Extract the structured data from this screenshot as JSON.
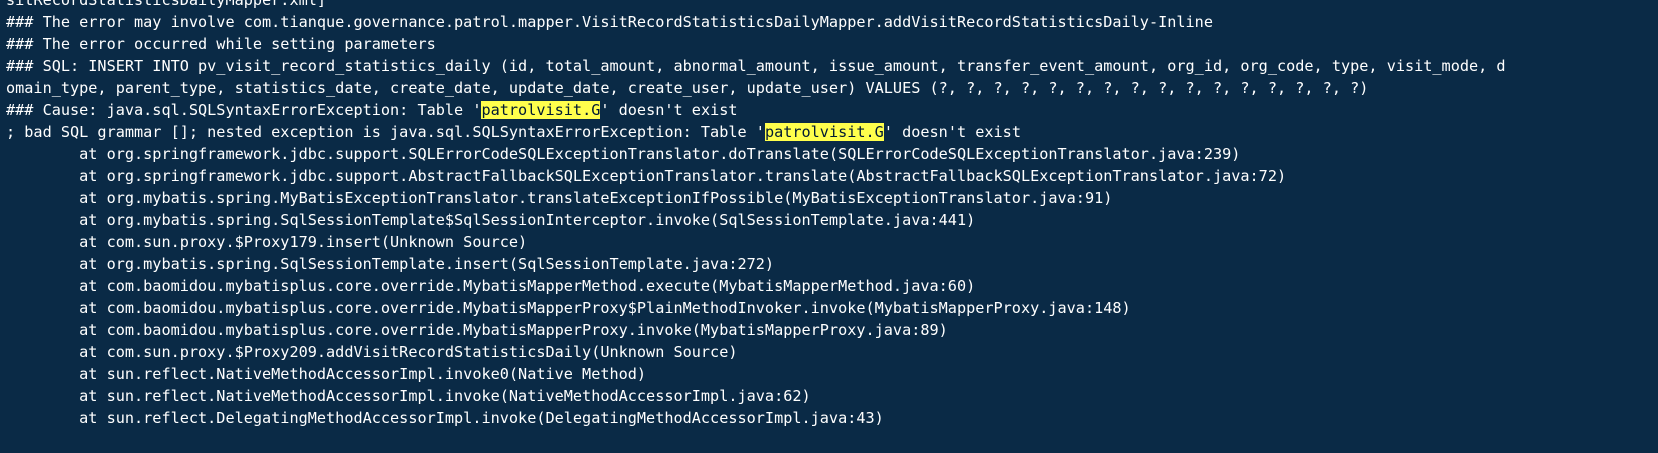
{
  "terminal": {
    "lines": [
      {
        "segments": [
          {
            "text": "sitRecordStatisticsDailyMapper.xml]"
          }
        ]
      },
      {
        "segments": [
          {
            "text": "### The error may involve com.tianque.governance.patrol.mapper.VisitRecordStatisticsDailyMapper.addVisitRecordStatisticsDaily-Inline"
          }
        ]
      },
      {
        "segments": [
          {
            "text": "### The error occurred while setting parameters"
          }
        ]
      },
      {
        "segments": [
          {
            "text": "### SQL: INSERT INTO pv_visit_record_statistics_daily (id, total_amount, abnormal_amount, issue_amount, transfer_event_amount, org_id, org_code, type, visit_mode, d"
          }
        ]
      },
      {
        "segments": [
          {
            "text": "omain_type, parent_type, statistics_date, create_date, update_date, create_user, update_user) VALUES (?, ?, ?, ?, ?, ?, ?, ?, ?, ?, ?, ?, ?, ?, ?, ?)"
          }
        ]
      },
      {
        "segments": [
          {
            "text": "### Cause: java.sql.SQLSyntaxErrorException: Table '"
          },
          {
            "text": "patrolvisit.G",
            "highlight": true
          },
          {
            "text": "' doesn't exist"
          }
        ]
      },
      {
        "segments": [
          {
            "text": "; bad SQL grammar []; nested exception is java.sql.SQLSyntaxErrorException: Table '"
          },
          {
            "text": "patrolvisit.G",
            "highlight": true
          },
          {
            "text": "' doesn't exist"
          }
        ]
      },
      {
        "segments": [
          {
            "text": "        at org.springframework.jdbc.support.SQLErrorCodeSQLExceptionTranslator.doTranslate(SQLErrorCodeSQLExceptionTranslator.java:239)"
          }
        ]
      },
      {
        "segments": [
          {
            "text": "        at org.springframework.jdbc.support.AbstractFallbackSQLExceptionTranslator.translate(AbstractFallbackSQLExceptionTranslator.java:72)"
          }
        ]
      },
      {
        "segments": [
          {
            "text": "        at org.mybatis.spring.MyBatisExceptionTranslator.translateExceptionIfPossible(MyBatisExceptionTranslator.java:91)"
          }
        ]
      },
      {
        "segments": [
          {
            "text": "        at org.mybatis.spring.SqlSessionTemplate$SqlSessionInterceptor.invoke(SqlSessionTemplate.java:441)"
          }
        ]
      },
      {
        "segments": [
          {
            "text": "        at com.sun.proxy.$Proxy179.insert(Unknown Source)"
          }
        ]
      },
      {
        "segments": [
          {
            "text": "        at org.mybatis.spring.SqlSessionTemplate.insert(SqlSessionTemplate.java:272)"
          }
        ]
      },
      {
        "segments": [
          {
            "text": "        at com.baomidou.mybatisplus.core.override.MybatisMapperMethod.execute(MybatisMapperMethod.java:60)"
          }
        ]
      },
      {
        "segments": [
          {
            "text": "        at com.baomidou.mybatisplus.core.override.MybatisMapperProxy$PlainMethodInvoker.invoke(MybatisMapperProxy.java:148)"
          }
        ]
      },
      {
        "segments": [
          {
            "text": "        at com.baomidou.mybatisplus.core.override.MybatisMapperProxy.invoke(MybatisMapperProxy.java:89)"
          }
        ]
      },
      {
        "segments": [
          {
            "text": "        at com.sun.proxy.$Proxy209.addVisitRecordStatisticsDaily(Unknown Source)"
          }
        ]
      },
      {
        "segments": [
          {
            "text": "        at sun.reflect.NativeMethodAccessorImpl.invoke0(Native Method)"
          }
        ]
      },
      {
        "segments": [
          {
            "text": "        at sun.reflect.NativeMethodAccessorImpl.invoke(NativeMethodAccessorImpl.java:62)"
          }
        ]
      },
      {
        "segments": [
          {
            "text": "        at sun.reflect.DelegatingMethodAccessorImpl.invoke(DelegatingMethodAccessorImpl.java:43)"
          }
        ]
      }
    ],
    "colors": {
      "background": "#0a2a46",
      "text": "#ffffff",
      "highlight_bg": "#ffff4c",
      "highlight_text": "#001a33"
    }
  }
}
